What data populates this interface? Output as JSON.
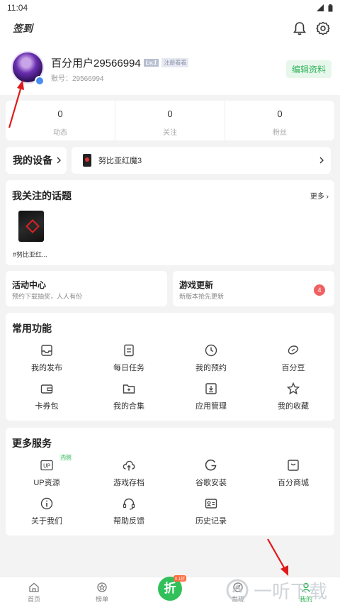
{
  "statusbar": {
    "time": "11:04"
  },
  "header": {
    "checkin": "签到"
  },
  "profile": {
    "name": "百分用户29566994",
    "level": "Lv.1",
    "tag": "注册看看",
    "account": "账号：29566994",
    "edit_label": "编辑资料"
  },
  "stats": [
    {
      "value": "0",
      "label": "动态"
    },
    {
      "value": "0",
      "label": "关注"
    },
    {
      "value": "0",
      "label": "粉丝"
    }
  ],
  "device": {
    "label": "我的设备",
    "name": "努比亚红魔3"
  },
  "topics": {
    "title": "我关注的话题",
    "more": "更多 ›",
    "items": [
      {
        "label": "#努比亚红..."
      }
    ]
  },
  "activity": {
    "title": "活动中心",
    "subtitle": "预约下载抽奖，人人有份"
  },
  "game_update": {
    "title": "游戏更新",
    "subtitle": "新版本抢先更新",
    "badge": "4"
  },
  "common": {
    "title": "常用功能",
    "items": [
      {
        "label": "我的发布",
        "icon": "inbox-icon"
      },
      {
        "label": "每日任务",
        "icon": "task-list-icon"
      },
      {
        "label": "我的预约",
        "icon": "clock-icon"
      },
      {
        "label": "百分豆",
        "icon": "bean-icon"
      },
      {
        "label": "卡券包",
        "icon": "wallet-icon"
      },
      {
        "label": "我的合集",
        "icon": "folder-plus-icon"
      },
      {
        "label": "应用管理",
        "icon": "download-box-icon"
      },
      {
        "label": "我的收藏",
        "icon": "star-icon"
      }
    ]
  },
  "more_services": {
    "title": "更多服务",
    "items": [
      {
        "label": "UP资源",
        "icon": "up-icon",
        "tag": "内测"
      },
      {
        "label": "游戏存档",
        "icon": "cloud-upload-icon"
      },
      {
        "label": "谷歌安装",
        "icon": "google-icon"
      },
      {
        "label": "百分商城",
        "icon": "shop-icon"
      },
      {
        "label": "关于我们",
        "icon": "info-icon"
      },
      {
        "label": "帮助反馈",
        "icon": "headset-icon"
      },
      {
        "label": "历史记录",
        "icon": "id-card-icon"
      }
    ]
  },
  "nav": [
    {
      "label": "首页",
      "icon": "home-icon"
    },
    {
      "label": "榜单",
      "icon": "medal-icon"
    },
    {
      "label": "",
      "icon": "discount-icon"
    },
    {
      "label": "发现",
      "icon": "discover-icon"
    },
    {
      "label": "我的",
      "icon": "user-icon"
    }
  ],
  "fab": {
    "label": "折",
    "tag": "0.1折"
  },
  "watermark": "一听下载",
  "colors": {
    "accent": "#2fb45a",
    "badge": "#f06060",
    "arrow": "#e0191b"
  }
}
